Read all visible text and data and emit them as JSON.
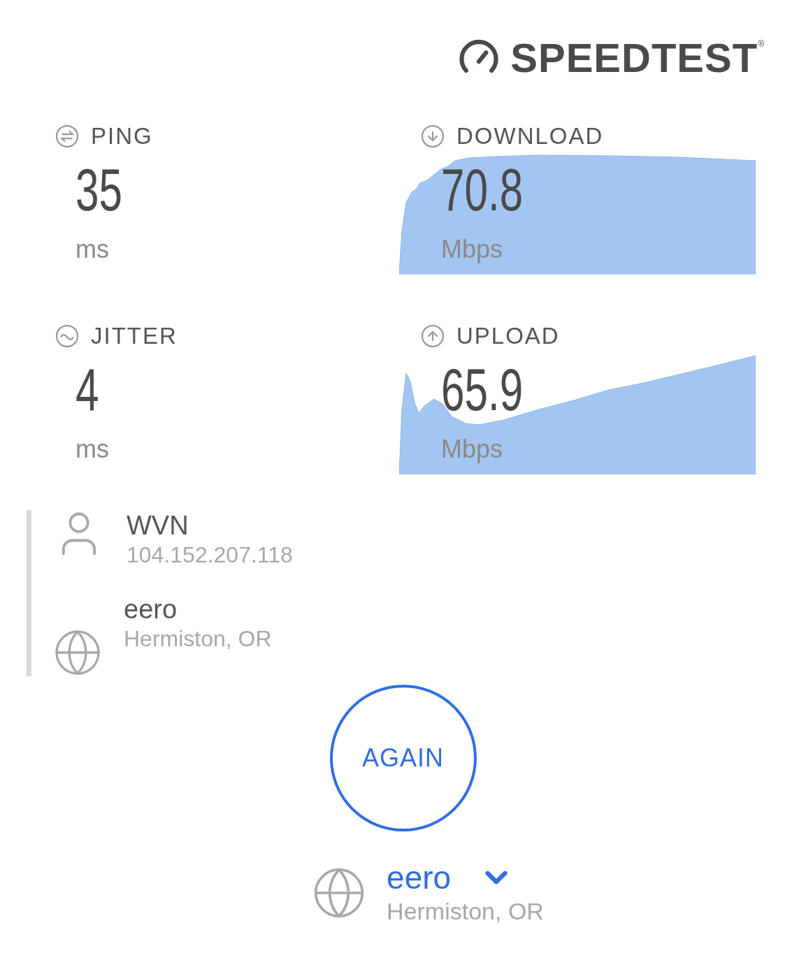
{
  "logo": {
    "text": "SPEEDTEST",
    "mark": "®"
  },
  "metrics": [
    {
      "kind": "ping",
      "label": "PING",
      "value": "35",
      "unit": "ms"
    },
    {
      "kind": "download",
      "label": "DOWNLOAD",
      "value": "70.8",
      "unit": "Mbps"
    },
    {
      "kind": "jitter",
      "label": "JITTER",
      "value": "4",
      "unit": "ms"
    },
    {
      "kind": "upload",
      "label": "UPLOAD",
      "value": "65.9",
      "unit": "Mbps"
    }
  ],
  "connection": {
    "provider": {
      "name": "WVN",
      "ip": "104.152.207.118"
    },
    "server": {
      "name": "eero",
      "location": "Hermiston, OR"
    }
  },
  "again_button": "AGAIN",
  "server_picker": {
    "name": "eero",
    "location": "Hermiston, OR"
  }
}
